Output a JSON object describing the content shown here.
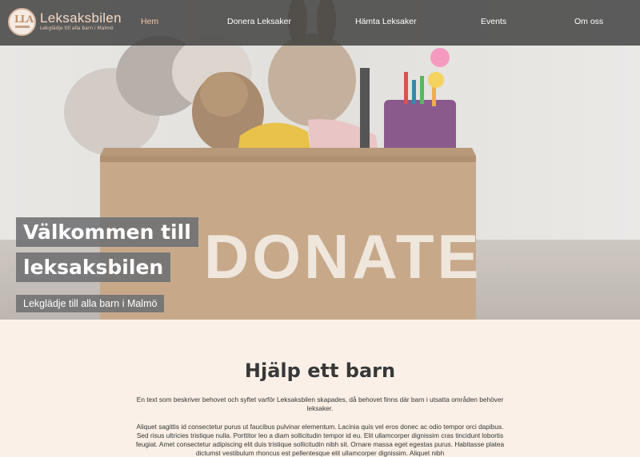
{
  "brand": {
    "logo_text": "LLA",
    "name": "Leksaksbilen",
    "tagline": "Lekglädje till alla barn i Malmö"
  },
  "nav": {
    "items": [
      {
        "label": "Hem",
        "active": true
      },
      {
        "label": "Donera Leksaker",
        "active": false
      },
      {
        "label": "Hämta Leksaker",
        "active": false
      },
      {
        "label": "Events",
        "active": false
      },
      {
        "label": "Om oss",
        "active": false
      }
    ]
  },
  "hero": {
    "title_line1": "Välkommen till",
    "title_line2": "leksaksbilen",
    "subtitle": "Lekglädje till alla barn i Malmö",
    "box_print": "DONATE"
  },
  "main": {
    "heading": "Hjälp ett barn",
    "paragraph1": "En text som beskriver behovet och syftet varför Leksaksbilen skapades, då behovet finns där barn i utsatta områden behöver leksaker.",
    "paragraph2": "Aliquet sagittis id consectetur purus ut faucibus pulvinar elementum. Lacinia quis vel eros donec ac odio tempor orci dapibus. Sed risus ultricies tristique nulla. Porttitor leo a diam sollicitudin tempor id eu. Elit ullamcorper dignissim cras tincidunt lobortis feugiat. Amet consectetur adipiscing elit duis tristique sollicitudin nibh sit. Ornare massa eget egestas purus. Habitasse platea dictumst vestibulum rhoncus est pellentesque elit ullamcorper dignissim. Aliquet nibh"
  },
  "colors": {
    "nav_bg": "#3c3c3c",
    "nav_active": "#f2c7a9",
    "brand_text": "#f3d9c5",
    "page_bg": "#fbf0e7",
    "hero_label_bg": "#6e7072",
    "heading": "#383838"
  }
}
